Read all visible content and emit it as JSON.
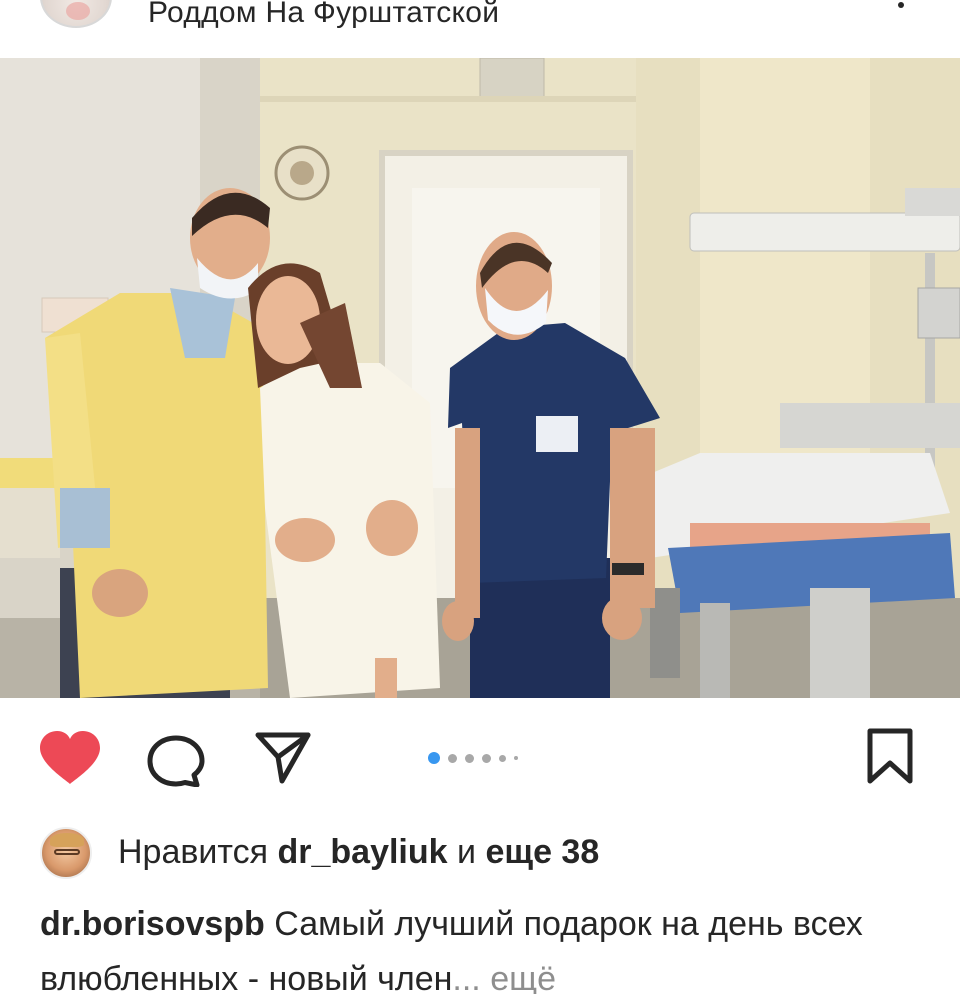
{
  "header": {
    "account_name": "Роддом На Фурштатской"
  },
  "actions": {
    "like_icon": "heart-filled-icon",
    "comment_icon": "comment-icon",
    "share_icon": "paper-plane-icon",
    "save_icon": "bookmark-icon",
    "liked": true,
    "like_color": "#ed4956"
  },
  "carousel": {
    "total_dots_visible": 6,
    "active_index": 1,
    "active_color": "#3897f0"
  },
  "likes": {
    "prefix": "Нравится",
    "user": "dr_bayliuk",
    "middle": "и",
    "suffix": "еще 38"
  },
  "caption": {
    "user": "dr.borisovspb",
    "text": "Самый лучший подарок на день всех влюбленных - новый член",
    "ellipsis": "...",
    "more_label": "ещё"
  }
}
